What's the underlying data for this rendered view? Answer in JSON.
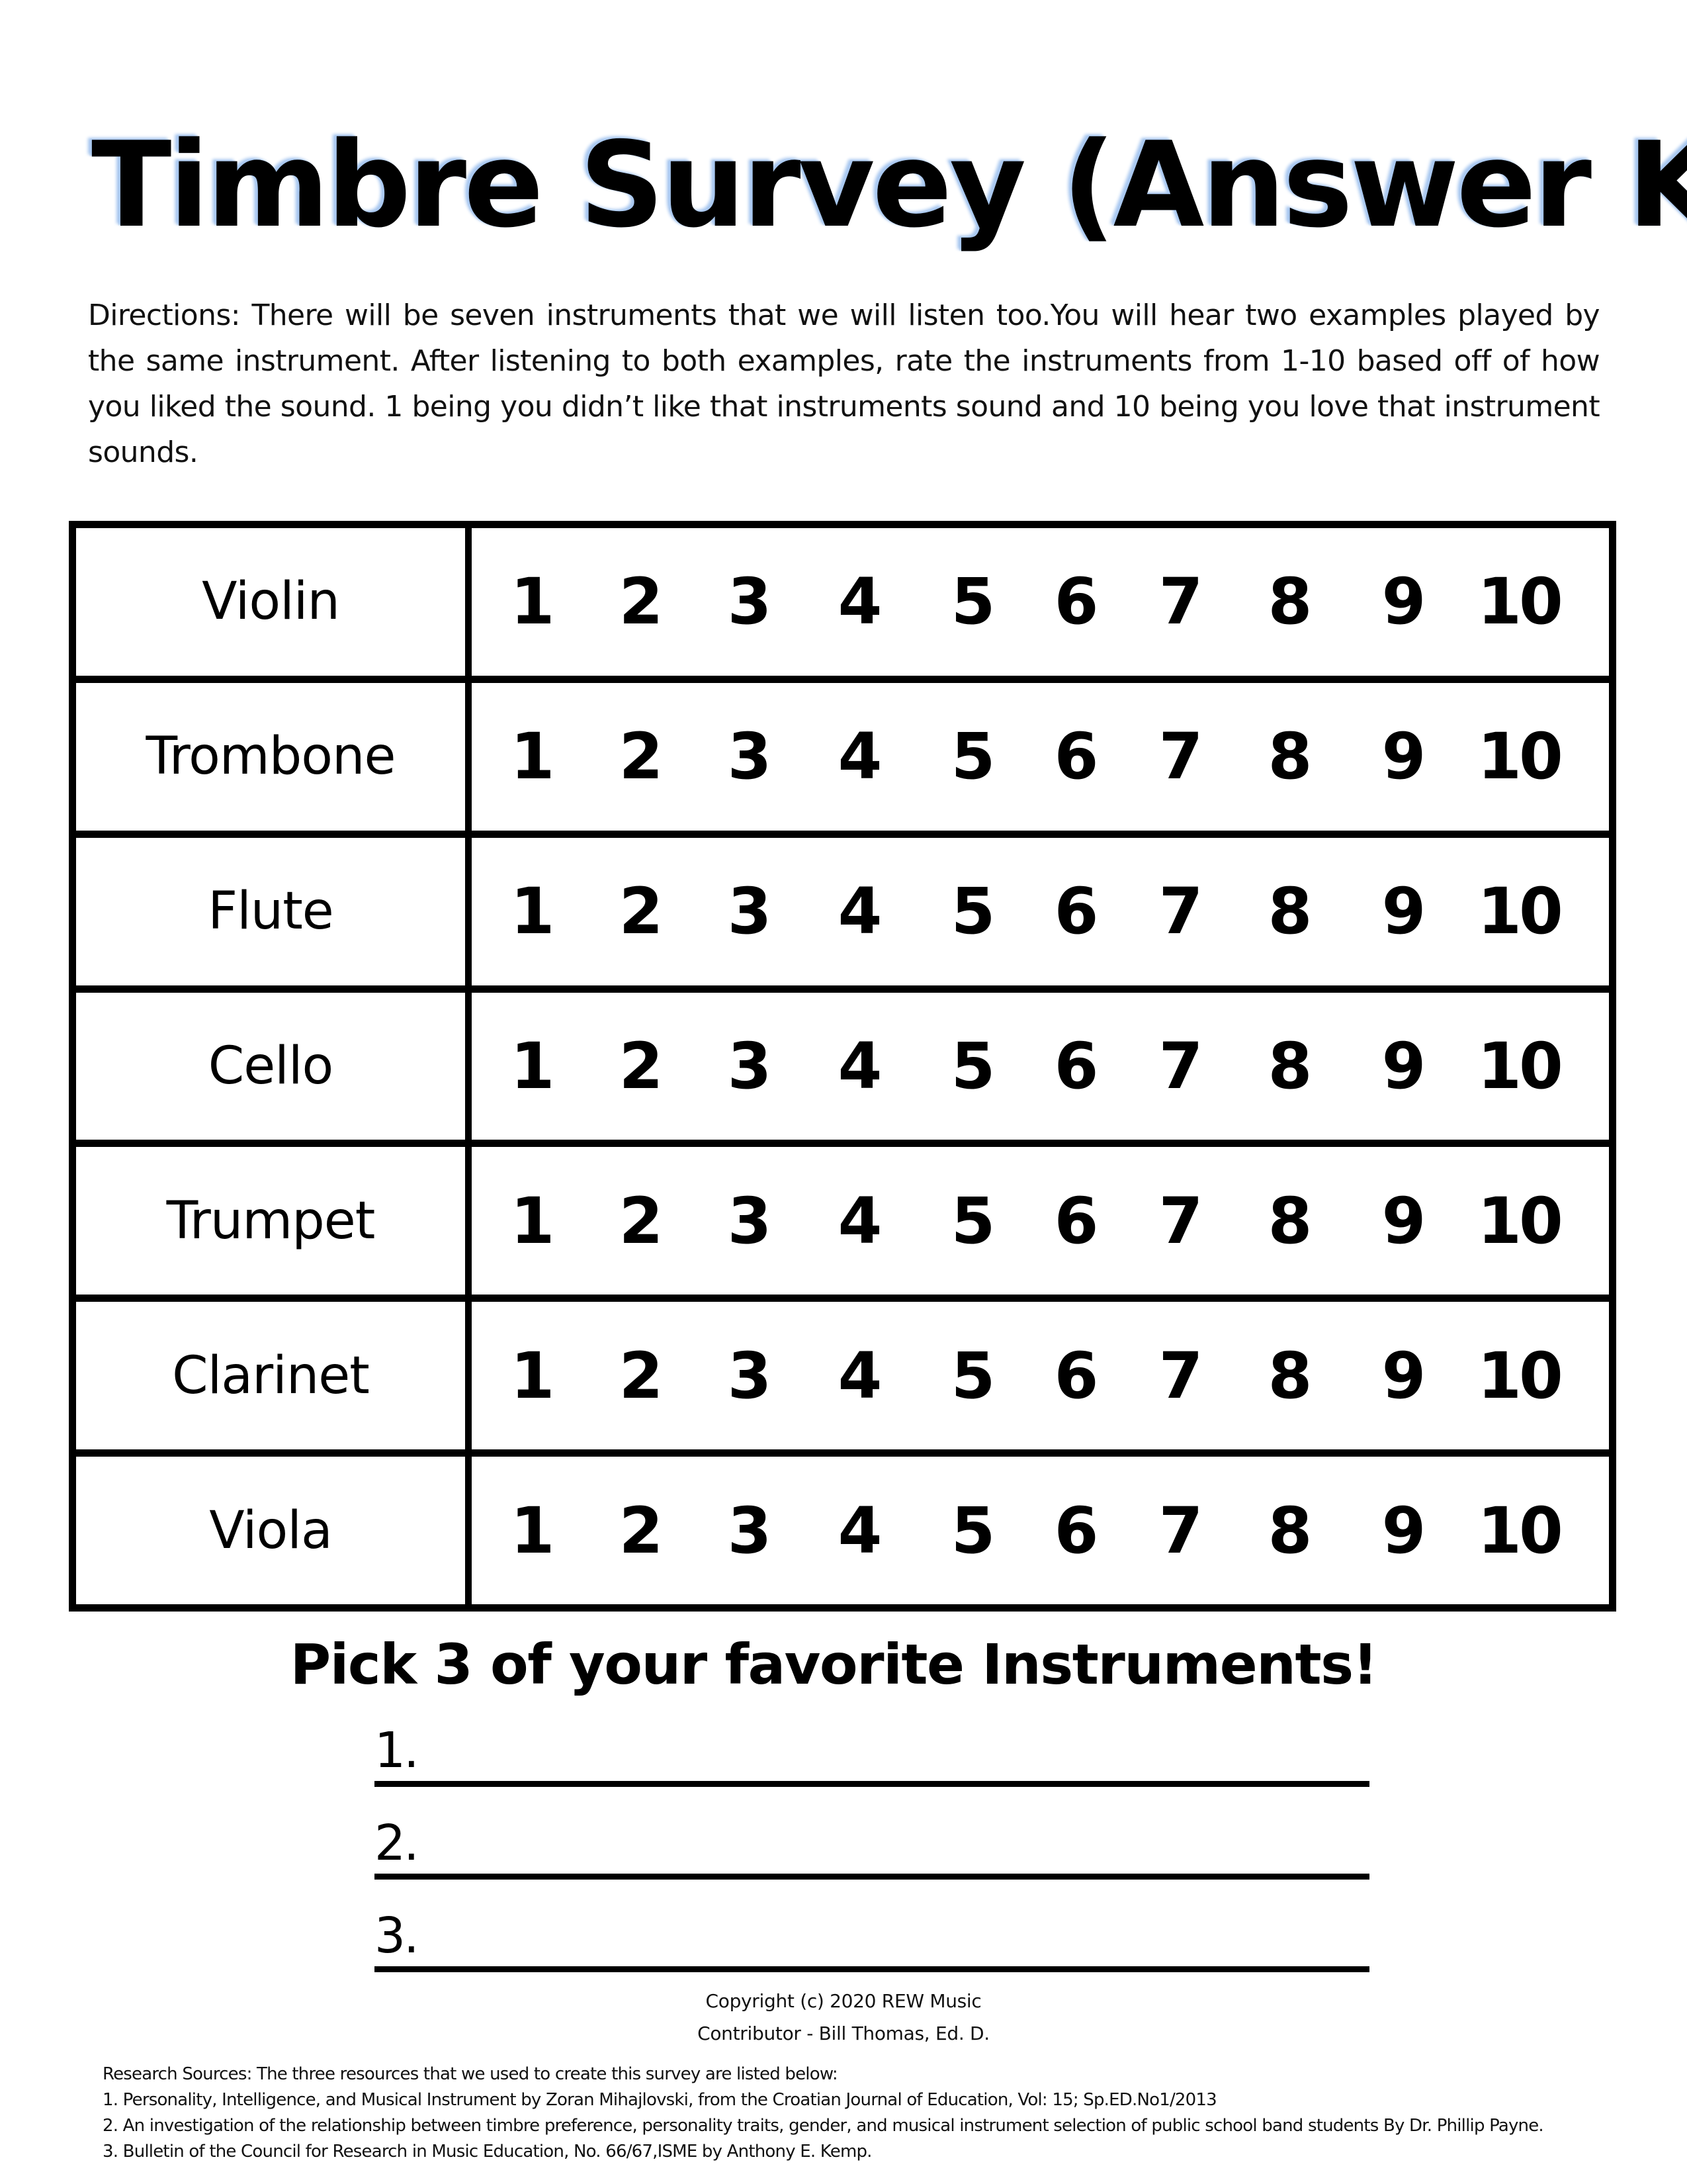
{
  "title": "Timbre Survey (Answer Key)",
  "directions": "Directions: There will be seven instruments that we will listen too.You will hear two examples played by the same instrument. After listening to both examples, rate the instruments from 1-10 based off of how you liked the sound. 1 being you didn’t like that instruments sound and 10 being you love that instrument sounds.",
  "survey": {
    "rating_scale": [
      "1",
      "2",
      "3",
      "4",
      "5",
      "6",
      "7",
      "8",
      "9",
      "10"
    ],
    "instruments": [
      {
        "name": "Violin"
      },
      {
        "name": "Trombone"
      },
      {
        "name": "Flute"
      },
      {
        "name": "Cello"
      },
      {
        "name": "Trumpet"
      },
      {
        "name": "Clarinet"
      },
      {
        "name": "Viola"
      }
    ]
  },
  "favorites": {
    "heading": "Pick 3 of your favorite Instruments!",
    "items": [
      {
        "number": "1.",
        "value": ""
      },
      {
        "number": "2.",
        "value": ""
      },
      {
        "number": "3.",
        "value": ""
      }
    ]
  },
  "credits": {
    "copyright": "Copyright (c) 2020 REW Music",
    "contributor": "Contributor - Bill Thomas, Ed. D."
  },
  "sources": {
    "intro": "Research Sources: The three resources that we used to create this survey are listed below:",
    "items": [
      "1. Personality, Intelligence, and Musical Instrument by Zoran Mihajlovski, from the Croatian Journal of Education, Vol: 15; Sp.ED.No1/2013",
      "2. An investigation of the relationship between timbre preference, personality traits, gender, and musical instrument selection of public school band students By Dr. Phillip Payne.",
      "3. Bulletin of the Council for Research in Music Education, No. 66/67,ISME by Anthony E. Kemp."
    ]
  },
  "colors": {
    "text": "#000000",
    "title_glow": "#a9c8f0",
    "background": "#ffffff"
  }
}
